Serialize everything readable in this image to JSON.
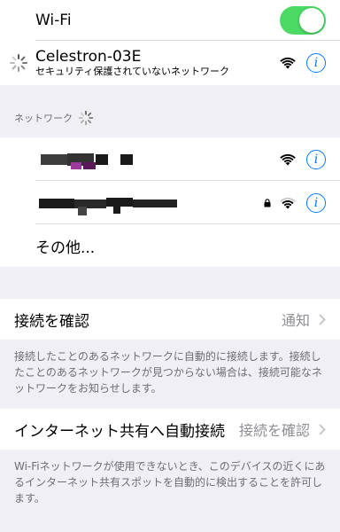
{
  "wifi": {
    "label": "Wi-Fi",
    "enabled": true
  },
  "connected_network": {
    "name": "Celestron-03E",
    "subtitle": "セキュリティ保護されていないネットワーク",
    "icons": [
      "spinner-icon",
      "wifi-signal-icon",
      "info-icon"
    ]
  },
  "networks_section": {
    "header": "ネットワーク"
  },
  "networks": [
    {
      "name_redacted": true,
      "secured": false
    },
    {
      "name_redacted": true,
      "secured": true
    }
  ],
  "other_label": "その他...",
  "ask_to_join": {
    "label": "接続を確認",
    "value": "通知",
    "footer": "接続したことのあるネットワークに自動的に接続します。接続したことのあるネットワークが見つからない場合は、接続可能なネットワークをお知らせします。"
  },
  "auto_join_hotspot": {
    "label": "インターネット共有へ自動接続",
    "value": "接続を確認",
    "footer": "Wi-Fiネットワークが使用できないとき、このデバイスの近くにあるインターネット共有スポットを自動的に検出することを許可します。"
  },
  "colors": {
    "toggle_on": "#4cd964",
    "accent": "#007aff",
    "background": "#efeff4"
  }
}
